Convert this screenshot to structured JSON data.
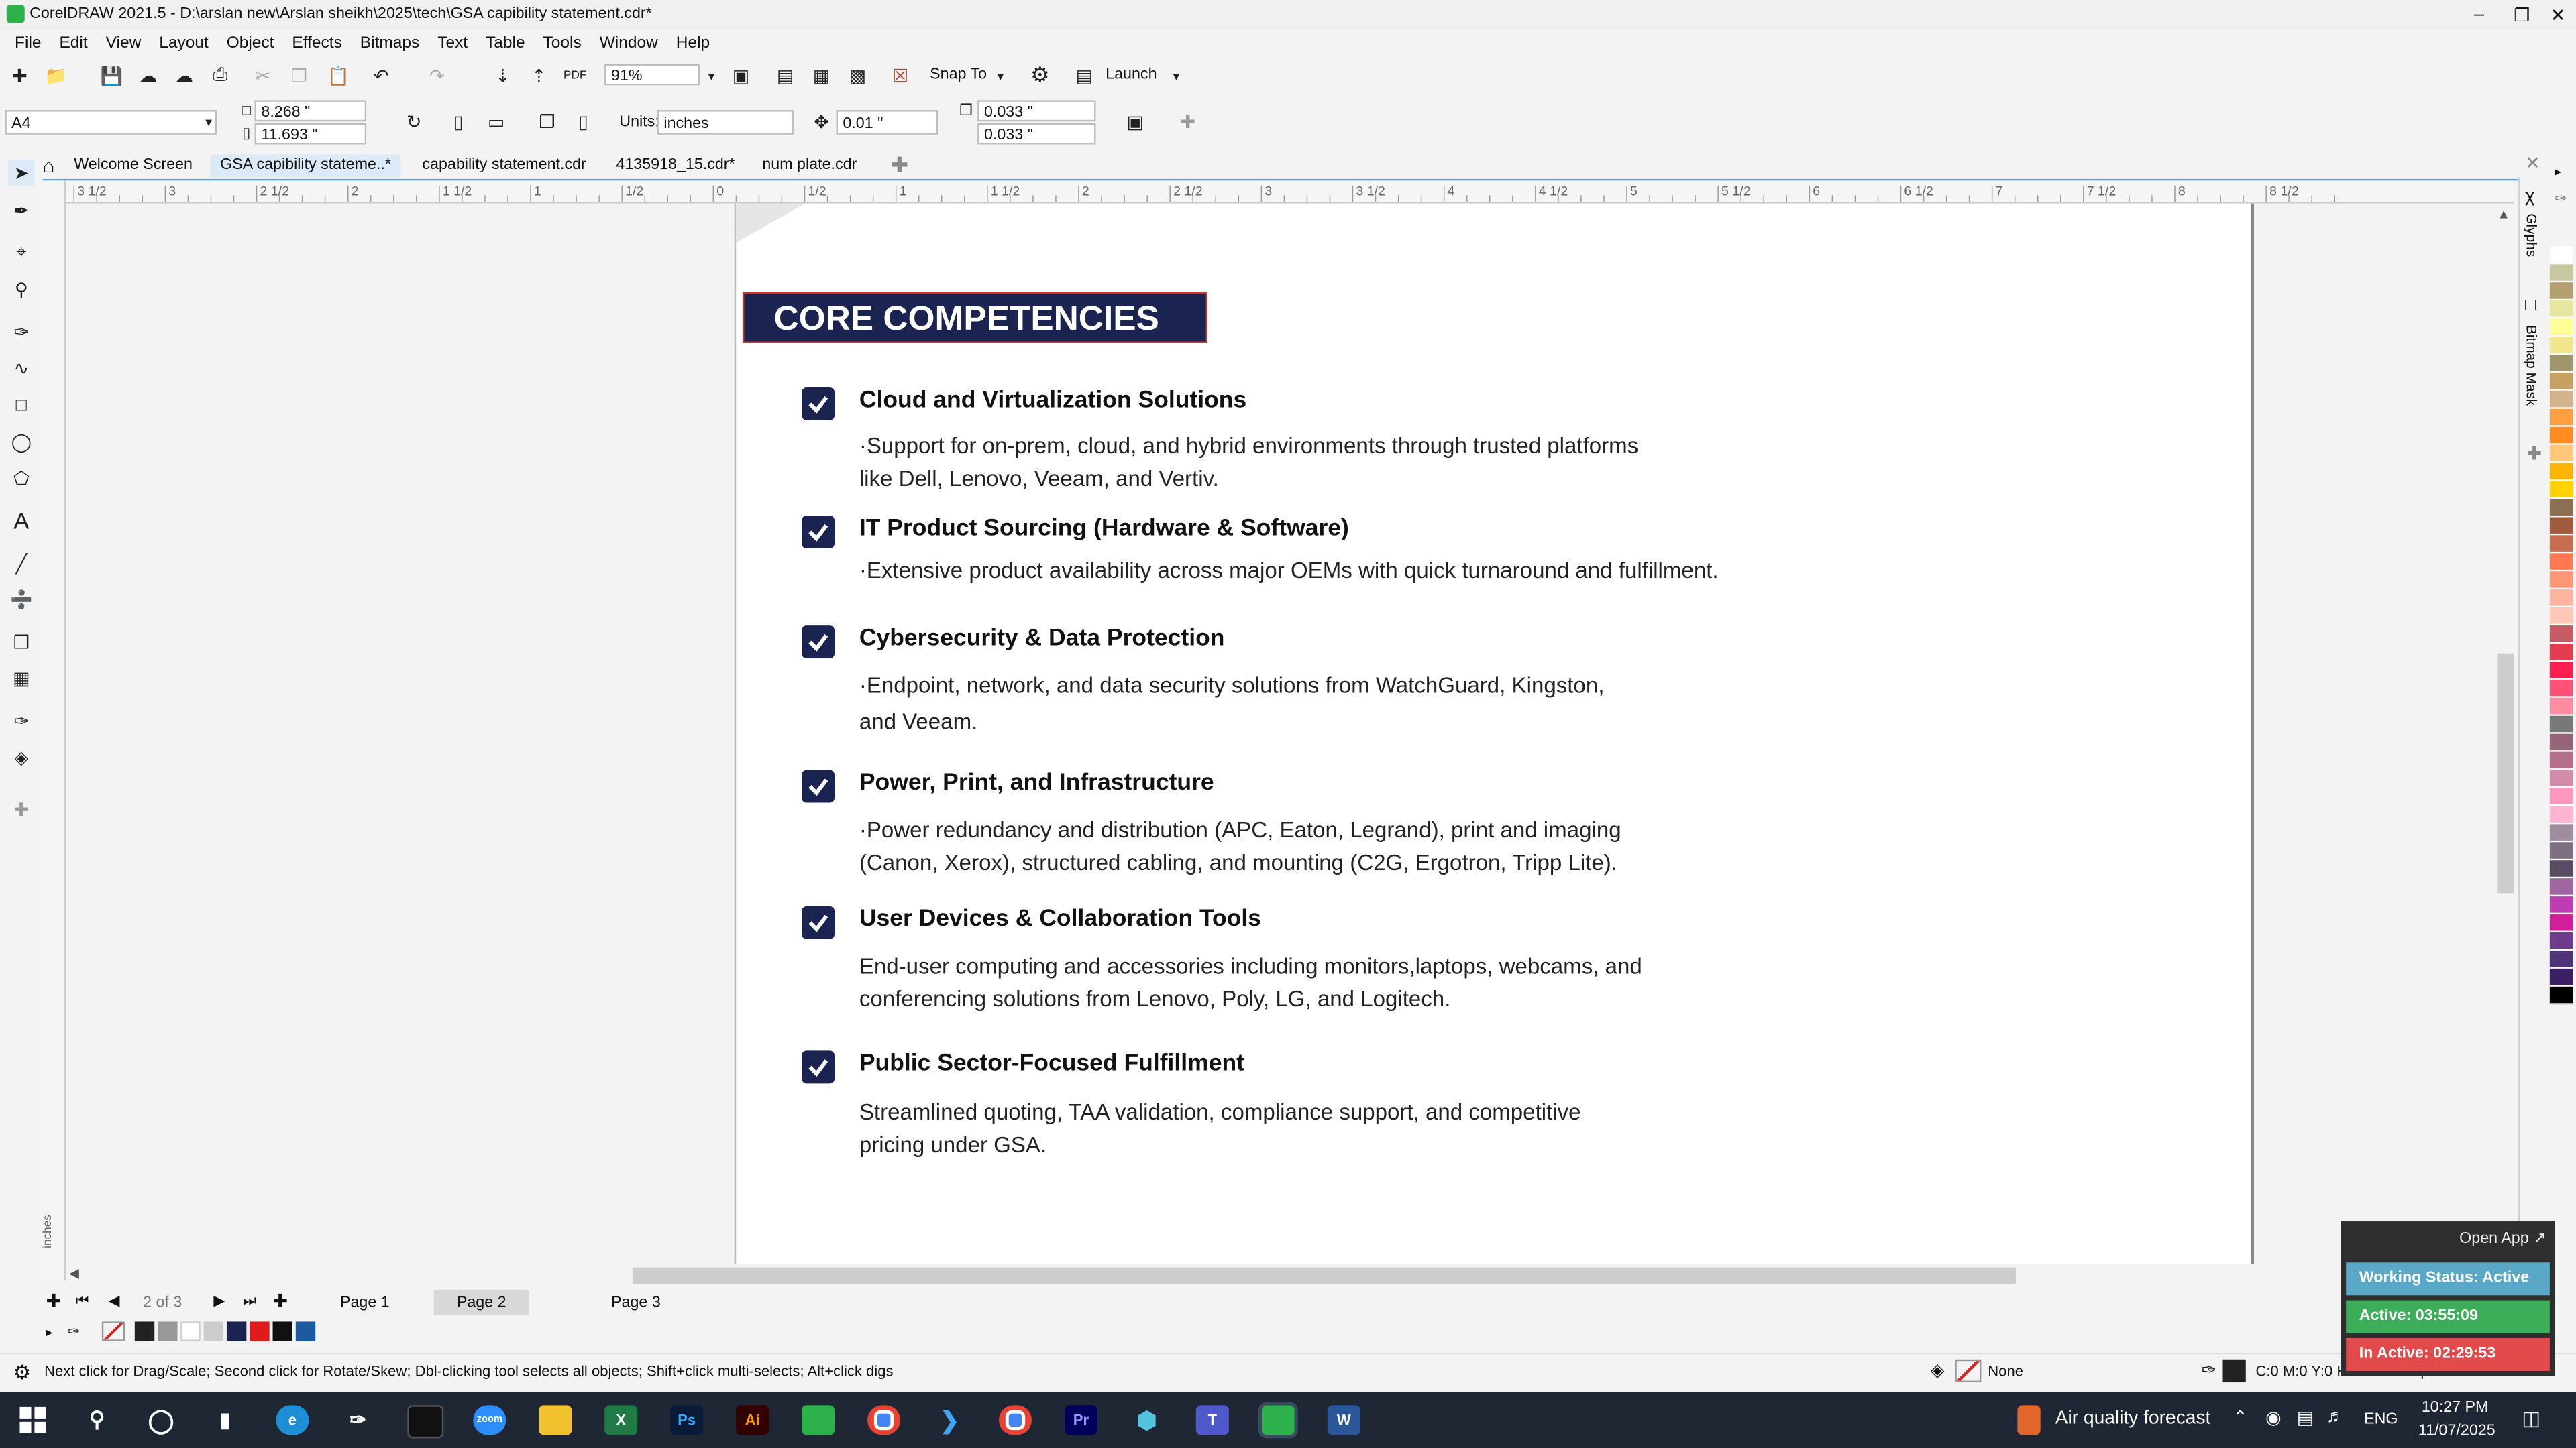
{
  "app": {
    "title": "CorelDRAW 2021.5 - D:\\arslan new\\Arslan sheikh\\2025\\tech\\GSA  capibility statement.cdr*"
  },
  "menu": [
    "File",
    "Edit",
    "View",
    "Layout",
    "Object",
    "Effects",
    "Bitmaps",
    "Text",
    "Table",
    "Tools",
    "Window",
    "Help"
  ],
  "toolbar": {
    "zoom": "91%",
    "snap_to": "Snap To",
    "launch": "Launch"
  },
  "property_bar": {
    "page_size": "A4",
    "width": "8.268 \"",
    "height": "11.693 \"",
    "units_label": "Units:",
    "units_value": "inches",
    "nudge": "0.01 \"",
    "dup_x": "0.033 \"",
    "dup_y": "0.033 \""
  },
  "tabs": [
    {
      "label": "Welcome Screen"
    },
    {
      "label": "GSA  capibility stateme..*"
    },
    {
      "label": "capability statement.cdr"
    },
    {
      "label": "4135918_15.cdr*"
    },
    {
      "label": "num plate.cdr"
    }
  ],
  "ruler": {
    "labels": [
      "3 1/2",
      "3",
      "2 1/2",
      "2",
      "1 1/2",
      "1",
      "1/2",
      "0",
      "1/2",
      "1",
      "1 1/2",
      "2",
      "2 1/2",
      "3",
      "3 1/2",
      "4",
      "4 1/2",
      "5",
      "5 1/2",
      "6",
      "6 1/2",
      "7",
      "7 1/2",
      "8",
      "8 1/2"
    ],
    "unit": "inches"
  },
  "document": {
    "heading": "CORE COMPETENCIES",
    "items": [
      {
        "title": "Cloud and Virtualization Solutions",
        "desc": "·Support for on-prem, cloud, and hybrid environments through trusted platforms\n like Dell, Lenovo, Veeam, and Vertiv."
      },
      {
        "title": "IT Product Sourcing (Hardware & Software)",
        "desc": "·Extensive product availability across major OEMs with quick turnaround and fulfillment."
      },
      {
        "title": "Cybersecurity & Data Protection",
        "desc": "·Endpoint, network, and data security solutions from WatchGuard, Kingston,\nand Veeam."
      },
      {
        "title": "Power, Print, and Infrastructure",
        "desc": "·Power redundancy and distribution (APC, Eaton, Legrand), print and imaging\n (Canon, Xerox), structured cabling, and mounting (C2G, Ergotron, Tripp Lite)."
      },
      {
        "title": "User Devices & Collaboration Tools",
        "desc": "End-user computing and accessories including monitors,laptops, webcams, and\nconferencing solutions from Lenovo, Poly, LG, and Logitech."
      },
      {
        "title": "Public Sector-Focused Fulfillment",
        "desc": "Streamlined quoting, TAA validation, compliance support, and competitive\npricing under GSA."
      }
    ]
  },
  "dockers": {
    "glyphs": "Glyphs",
    "bitmap_mask": "Bitmap Mask"
  },
  "page_nav": {
    "counter": "2 of 3",
    "pages": [
      "Page 1",
      "Page 2",
      "Page 3"
    ],
    "active": "Page 2"
  },
  "status": {
    "hint": "Next click for Drag/Scale; Second click for Rotate/Skew; Dbl-clicking tool selects all objects; Shift+click multi-selects; Alt+click digs",
    "fill": "None",
    "outline": "C:0 M:0 Y:0 K:100  0.500 pt"
  },
  "widget": {
    "open_app": "Open App ↗",
    "working_status": "Working Status: Active",
    "active": "Active: 03:55:09",
    "inactive": "In Active: 02:29:53"
  },
  "taskbar": {
    "weather": "Air quality forecast",
    "lang": "ENG",
    "time": "10:27 PM",
    "date": "11/07/2025"
  },
  "colors": {
    "banner_bg": "#1b2350",
    "banner_border": "#c0392b",
    "tab_accent": "#58a4e0",
    "taskbar_bg": "#1f2735",
    "widget_status": "#5aa8c8",
    "widget_active": "#3cae5a",
    "widget_inactive": "#e24b4b"
  },
  "palette": [
    "#ffffff",
    "#c8c8a0",
    "#b4a06e",
    "#e6e6a0",
    "#ffff96",
    "#f0e68c",
    "#a0966e",
    "#c8a064",
    "#d2b48c",
    "#ffa040",
    "#ff8c1e",
    "#ffc878",
    "#ffb400",
    "#ffd200",
    "#8c6e50",
    "#a05a3c",
    "#c86e50",
    "#ff7850",
    "#ff9678",
    "#ffb4a0",
    "#ffc8b4",
    "#c85a64",
    "#e63c50",
    "#ff1e50",
    "#ff5078",
    "#ff8ca0",
    "#787878",
    "#966478",
    "#b46e8c",
    "#d28caa",
    "#ff96be",
    "#ffb4d2",
    "#a08ca0",
    "#7d6e82",
    "#5a4b64",
    "#a064a0",
    "#be3cb4",
    "#d21e9b",
    "#6e3c8c",
    "#503278",
    "#3c1e64",
    "#000000"
  ]
}
